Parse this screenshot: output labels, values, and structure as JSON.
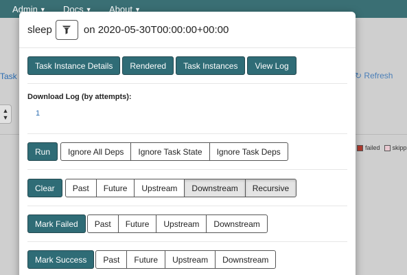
{
  "topnav": {
    "items": [
      {
        "label": "Admin"
      },
      {
        "label": "Docs"
      },
      {
        "label": "About"
      }
    ]
  },
  "background": {
    "left_link": "Task",
    "refresh_label": "Refresh",
    "legend": [
      {
        "label": "failed",
        "color": "#b03a2e"
      },
      {
        "label": "skipp",
        "color": "#e8c8d0"
      }
    ]
  },
  "modal": {
    "task_id": "sleep",
    "on_label": "on",
    "execution_date": "2020-05-30T00:00:00+00:00",
    "nav_buttons": [
      "Task Instance Details",
      "Rendered",
      "Task Instances",
      "View Log"
    ],
    "download": {
      "title": "Download Log (by attempts):",
      "attempts": [
        "1"
      ]
    },
    "run": {
      "label": "Run",
      "options": [
        "Ignore All Deps",
        "Ignore Task State",
        "Ignore Task Deps"
      ]
    },
    "clear": {
      "label": "Clear",
      "options": [
        "Past",
        "Future",
        "Upstream",
        "Downstream",
        "Recursive"
      ],
      "pressed": [
        "Downstream",
        "Recursive"
      ]
    },
    "mark_failed": {
      "label": "Mark Failed",
      "options": [
        "Past",
        "Future",
        "Upstream",
        "Downstream"
      ]
    },
    "mark_success": {
      "label": "Mark Success",
      "options": [
        "Past",
        "Future",
        "Upstream",
        "Downstream"
      ]
    }
  },
  "colors": {
    "primary": "#2f6c76",
    "navbar": "#3a6f74"
  }
}
